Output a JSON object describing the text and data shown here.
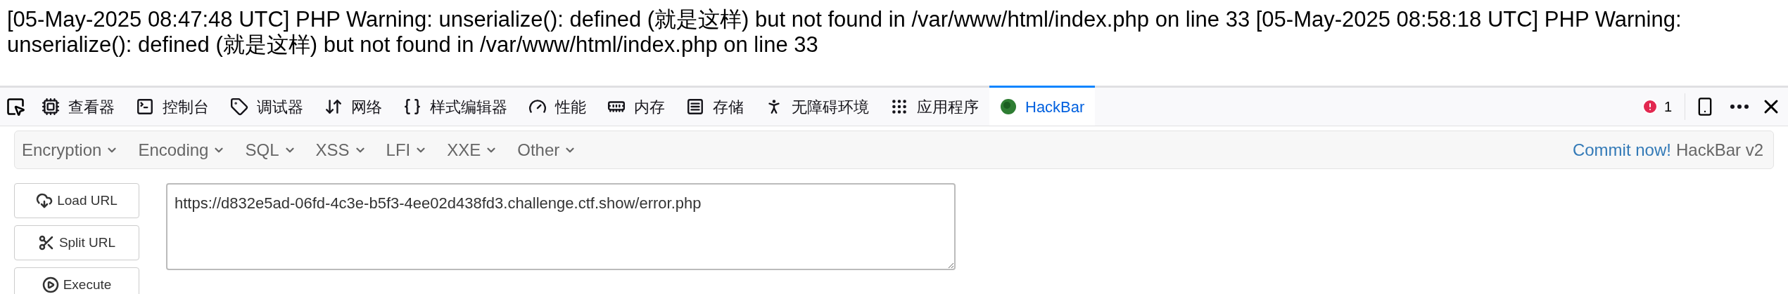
{
  "page_text": "[05-May-2025 08:47:48 UTC] PHP Warning: unserialize(): defined (就是这样) but not found in /var/www/html/index.php on line 33 [05-May-2025 08:58:18 UTC] PHP Warning: unserialize(): defined (就是这样) but not found in /var/www/html/index.php on line 33",
  "devtools": {
    "tabs": [
      {
        "label": "查看器",
        "selected": false
      },
      {
        "label": "控制台",
        "selected": false
      },
      {
        "label": "调试器",
        "selected": false
      },
      {
        "label": "网络",
        "selected": false
      },
      {
        "label": "样式编辑器",
        "selected": false
      },
      {
        "label": "性能",
        "selected": false
      },
      {
        "label": "内存",
        "selected": false
      },
      {
        "label": "存储",
        "selected": false
      },
      {
        "label": "无障碍环境",
        "selected": false
      },
      {
        "label": "应用程序",
        "selected": false
      },
      {
        "label": "HackBar",
        "selected": true
      }
    ],
    "error_count": "1"
  },
  "hackbar": {
    "menus": [
      "Encryption",
      "Encoding",
      "SQL",
      "XSS",
      "LFI",
      "XXE",
      "Other"
    ],
    "commit_link": "Commit now!",
    "version": "HackBar v2",
    "buttons": [
      "Load URL",
      "Split URL",
      "Execute"
    ],
    "url": "https://d832e5ad-06fd-4c3e-b5f3-4ee02d438fd3.challenge.ctf.show/error.php"
  }
}
